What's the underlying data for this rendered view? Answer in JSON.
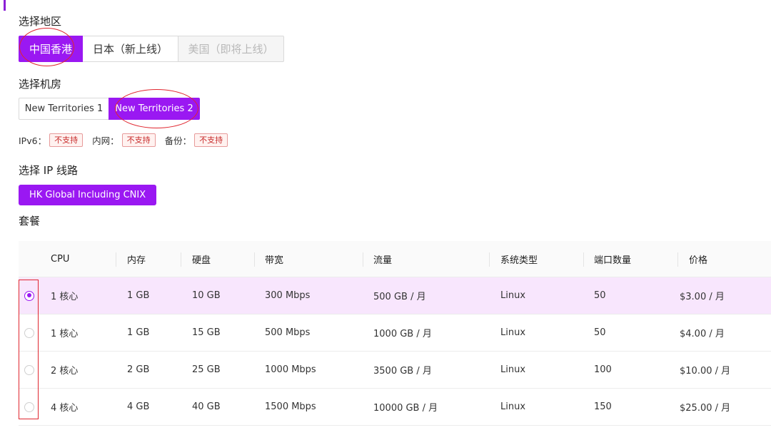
{
  "region": {
    "title": "选择地区",
    "options": [
      {
        "label": "中国香港",
        "state": "active"
      },
      {
        "label": "日本（新上线）",
        "state": "normal"
      },
      {
        "label": "美国（即将上线）",
        "state": "disabled"
      }
    ]
  },
  "datacenter": {
    "title": "选择机房",
    "options": [
      {
        "label": "New Territories 1",
        "state": "normal"
      },
      {
        "label": "New Territories 2",
        "state": "active"
      }
    ]
  },
  "features": [
    {
      "label": "IPv6：",
      "value": "不支持"
    },
    {
      "label": "内网：",
      "value": "不支持"
    },
    {
      "label": "备份：",
      "value": "不支持"
    }
  ],
  "ip_line": {
    "title": "选择 IP 线路",
    "option": "HK Global Including CNIX"
  },
  "plans": {
    "title": "套餐",
    "columns": [
      "CPU",
      "内存",
      "硬盘",
      "带宽",
      "流量",
      "系统类型",
      "端口数量",
      "价格"
    ],
    "rows": [
      {
        "selected": true,
        "cpu": "1 核心",
        "memory": "1 GB",
        "disk": "10 GB",
        "bandwidth": "300 Mbps",
        "traffic": "500 GB / 月",
        "os": "Linux",
        "ports": "50",
        "price": "$3.00 / 月"
      },
      {
        "selected": false,
        "cpu": "1 核心",
        "memory": "1 GB",
        "disk": "15 GB",
        "bandwidth": "500 Mbps",
        "traffic": "1000 GB / 月",
        "os": "Linux",
        "ports": "50",
        "price": "$4.00 / 月"
      },
      {
        "selected": false,
        "cpu": "2 核心",
        "memory": "2 GB",
        "disk": "25 GB",
        "bandwidth": "1000 Mbps",
        "traffic": "3500 GB / 月",
        "os": "Linux",
        "ports": "100",
        "price": "$10.00 / 月"
      },
      {
        "selected": false,
        "cpu": "4 核心",
        "memory": "4 GB",
        "disk": "40 GB",
        "bandwidth": "1500 Mbps",
        "traffic": "10000 GB / 月",
        "os": "Linux",
        "ports": "150",
        "price": "$25.00 / 月"
      }
    ]
  },
  "colors": {
    "accent": "#9a18f2",
    "selected_row": "#f8e6fd",
    "tag_text": "#c62828",
    "annotation": "#e0262f"
  }
}
